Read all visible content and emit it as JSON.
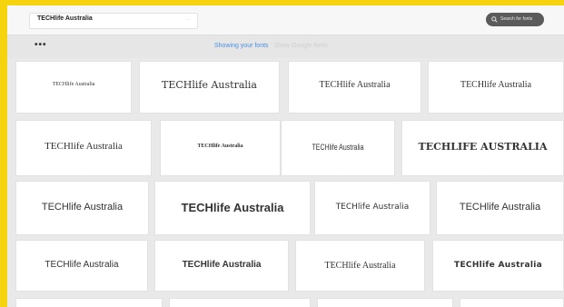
{
  "search": {
    "value": "TECHlife Australia",
    "hint": "..."
  },
  "header": {
    "button_label": "Search for fonts"
  },
  "subbar": {
    "more_label": "•••",
    "tab_active": "Showing your fonts",
    "tab_inactive": "Show Google fonts"
  },
  "sample_text": "TECHlife Australia",
  "cards": [
    {
      "text": "TECHlife Australia",
      "meta": "..."
    },
    {
      "text": "TECHlife Australia",
      "meta": "..."
    },
    {
      "text": "TECHlife Australia",
      "meta": "..."
    },
    {
      "text": "TECHlife Australia",
      "meta": "..."
    },
    {
      "text": "TECHlife Australia",
      "meta": "..."
    },
    {
      "text": "TECHlife Australia",
      "meta": "..."
    },
    {
      "text": "TECHlife Australia",
      "meta": "..."
    },
    {
      "text": "TECHLIFE AUSTRALIA",
      "meta": "..."
    },
    {
      "text": "TECHlife Australia",
      "meta": "..."
    },
    {
      "text": "TECHlife Australia",
      "meta": "..."
    },
    {
      "text": "TECHlife Australia",
      "meta": "..."
    },
    {
      "text": "TECHlife Australia",
      "meta": "..."
    },
    {
      "text": "TECHlife Australia",
      "meta": "..."
    },
    {
      "text": "TECHlife Australia",
      "meta": "..."
    },
    {
      "text": "TECHlife Australia",
      "meta": "..."
    },
    {
      "text": "TECHlife Australia",
      "meta": "..."
    }
  ],
  "colors": {
    "frame": "#f5d40f",
    "accent_blue": "#4a90e2",
    "button_dark": "#5b5b5b"
  },
  "icons": {
    "search": "search-icon"
  }
}
